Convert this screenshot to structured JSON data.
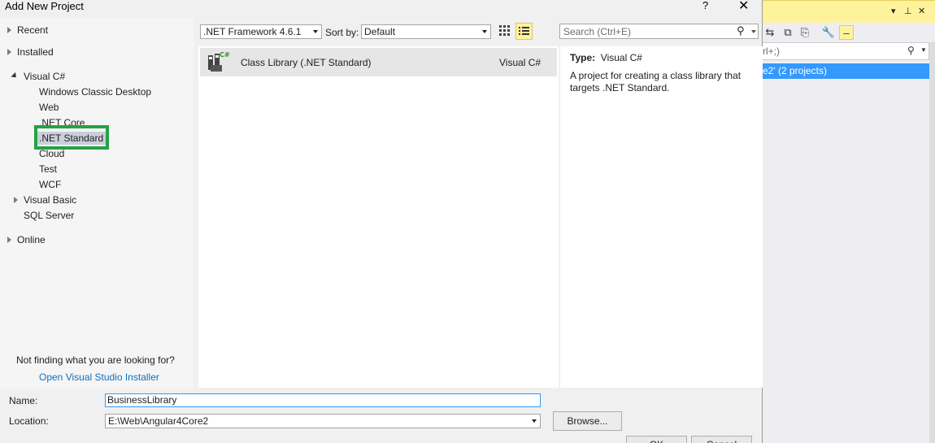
{
  "dialog": {
    "title": "Add New Project",
    "help_glyph": "?",
    "close_glyph": "✕"
  },
  "tree": {
    "recent": "Recent",
    "installed": "Installed",
    "visual_csharp": "Visual C#",
    "children": [
      "Windows Classic Desktop",
      "Web",
      ".NET Core",
      ".NET Standard",
      "Cloud",
      "Test",
      "WCF"
    ],
    "selected": ".NET Standard",
    "visual_basic": "Visual Basic",
    "sql_server": "SQL Server",
    "online": "Online",
    "not_finding": "Not finding what you are looking for?",
    "installer_link": "Open Visual Studio Installer"
  },
  "toolbar": {
    "framework": ".NET Framework 4.6.1",
    "sort_by_label": "Sort by:",
    "sort_by_value": "Default",
    "search_placeholder": "Search (Ctrl+E)"
  },
  "templates": [
    {
      "name": "Class Library (.NET Standard)",
      "language": "Visual C#",
      "icon": "class-library-csharp-icon"
    }
  ],
  "details": {
    "type_label": "Type:",
    "type_value": "Visual C#",
    "description": "A project for creating a class library that targets .NET Standard."
  },
  "form": {
    "name_label": "Name:",
    "name_value": "BusinessLibrary",
    "location_label": "Location:",
    "location_value": "E:\\Web\\Angular4Core2",
    "browse_label": "Browse...",
    "ok_label": "OK",
    "cancel_label": "Cancel"
  },
  "background_window": {
    "search_fragment": "rl+;)",
    "selected_text": "e2' (2 projects)"
  },
  "colors": {
    "highlight_box": "#25a244",
    "selection_blue": "#3399ff",
    "toolbar_highlight": "#fff29d",
    "link": "#0e70c0"
  }
}
